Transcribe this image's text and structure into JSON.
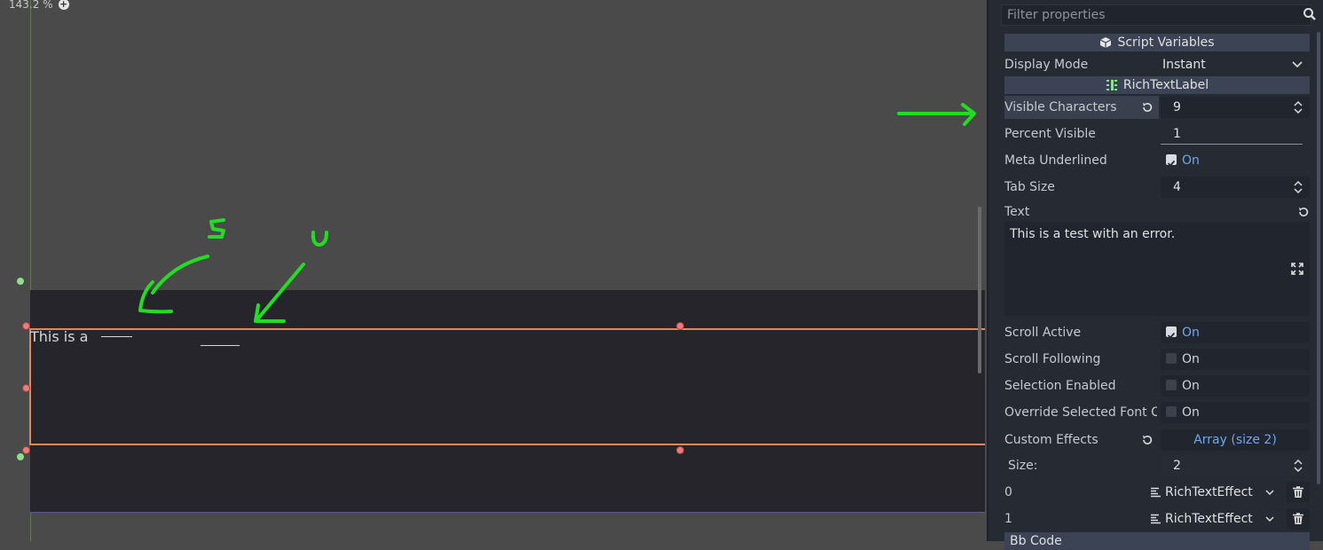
{
  "viewport": {
    "zoom_label": "143.2 %",
    "label_text": "This is a"
  },
  "inspector": {
    "filter_placeholder": "Filter properties",
    "sections": {
      "script_variables": "Script Variables",
      "richtextlabel": "RichTextLabel",
      "bbcode": "Bb Code"
    },
    "display_mode": {
      "label": "Display Mode",
      "value": "Instant"
    },
    "visible_characters": {
      "label": "Visible Characters",
      "value": "9"
    },
    "percent_visible": {
      "label": "Percent Visible",
      "value": "1"
    },
    "meta_underlined": {
      "label": "Meta Underlined",
      "value": "On"
    },
    "tab_size": {
      "label": "Tab Size",
      "value": "4"
    },
    "text": {
      "label": "Text",
      "value": "This is a test with an error."
    },
    "scroll_active": {
      "label": "Scroll Active",
      "value": "On"
    },
    "scroll_following": {
      "label": "Scroll Following",
      "value": "On"
    },
    "selection_enabled": {
      "label": "Selection Enabled",
      "value": "On"
    },
    "override_selected": {
      "label": "Override Selected Font C",
      "value": "On"
    },
    "custom_effects": {
      "label": "Custom Effects",
      "value": "Array (size 2)"
    },
    "size": {
      "label": "Size:",
      "value": "2"
    },
    "effects": [
      {
        "index": "0",
        "value": "RichTextEffect"
      },
      {
        "index": "1",
        "value": "RichTextEffect"
      }
    ]
  },
  "annotations": {
    "s_label": "S",
    "u_label": "U"
  },
  "colors": {
    "annotation_green": "#22dd22",
    "selection_orange": "#d98a63",
    "accent_blue": "#6fa8ee"
  },
  "icons": [
    "zoom-in-icon",
    "search-icon",
    "script-icon",
    "richtextlabel-icon",
    "reset-icon",
    "spinner-icon",
    "dropdown-icon",
    "checkbox-icon",
    "expand-icon",
    "delete-icon",
    "resource-icon"
  ]
}
